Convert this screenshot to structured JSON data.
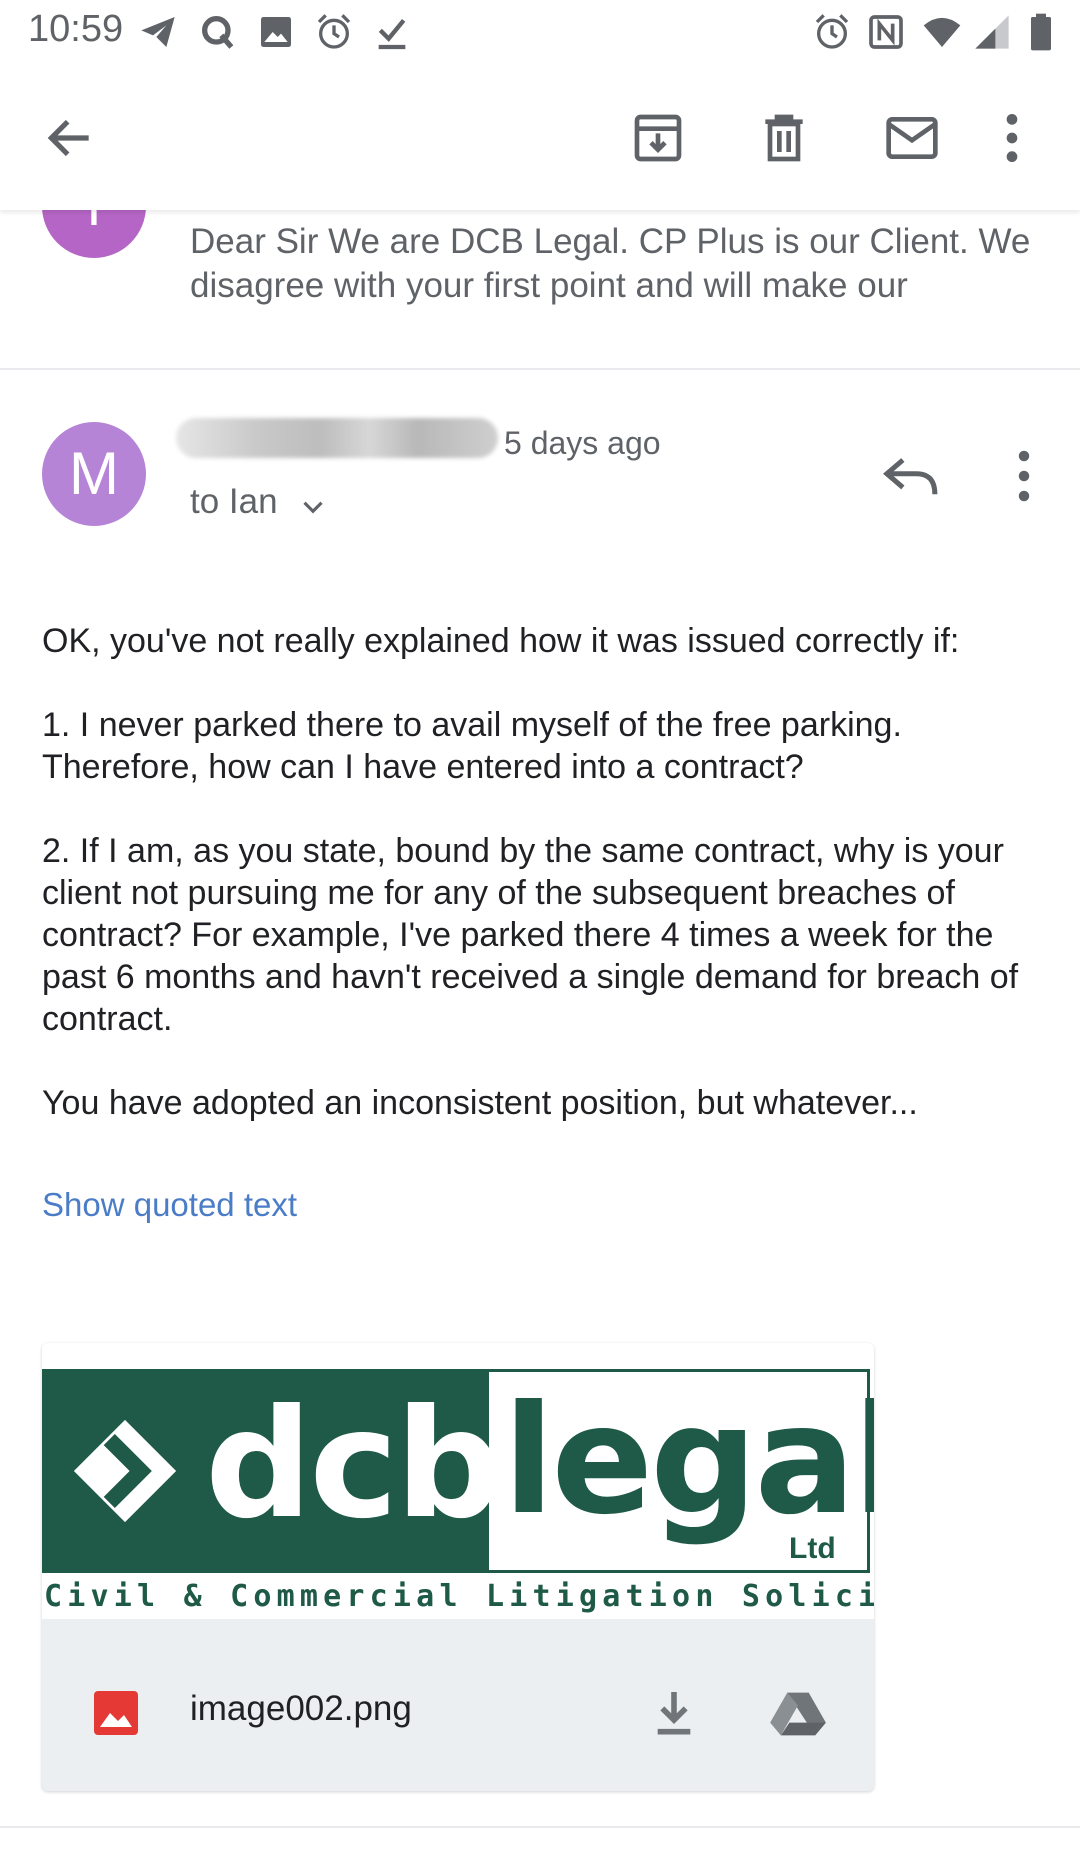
{
  "status_bar": {
    "time": "10:59",
    "left_icons": [
      "telegram-icon",
      "q-icon",
      "image-icon",
      "alarm-icon",
      "check-icon"
    ],
    "right_icons": [
      "alarm-icon",
      "nfc-icon",
      "wifi-icon",
      "signal-icon",
      "battery-icon"
    ]
  },
  "app_bar": {
    "icons": [
      "back-arrow-icon",
      "archive-icon",
      "delete-icon",
      "mark-unread-icon",
      "more-vert-icon"
    ]
  },
  "previous_message": {
    "avatar_letter": "T",
    "avatar_color": "#b565c5",
    "snippet": "Dear Sir We are DCB Legal. CP Plus is our Client. We disagree with your first point and will make our"
  },
  "message": {
    "avatar_letter": "M",
    "avatar_color": "#b684d6",
    "time_ago": "5 days ago",
    "to_line": "to Ian",
    "body": [
      "OK, you've not really explained how it was issued correctly if:",
      "1. I never parked there to avail myself of the free parking. Therefore, how can I have entered into a contract?",
      "2. If I am, as you state, bound by the same contract, why is your client not pursuing me for any of the subsequent breaches of contract? For example, I've parked there 4 times a week for the past 6 months and havn't received a single demand for breach of contract.",
      "You have adopted an inconsistent position, but whatever..."
    ],
    "show_quoted_label": "Show quoted text"
  },
  "attachment": {
    "logo": {
      "left_word": "dcb",
      "right_word": "legal",
      "suffix": "Ltd",
      "tagline": "Civil & Commercial Litigation Solicitors",
      "brand_color": "#1e5a47"
    },
    "filename": "image002.png",
    "icons": [
      "image-file-icon",
      "download-icon",
      "drive-icon"
    ]
  }
}
